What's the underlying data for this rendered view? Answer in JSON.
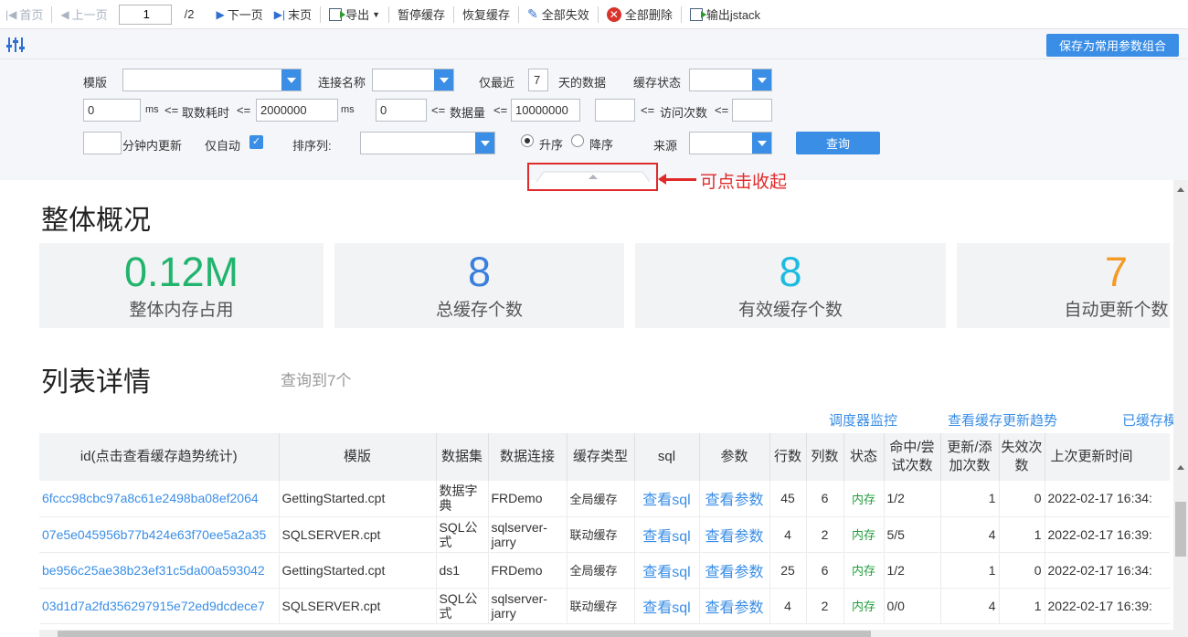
{
  "toolbar": {
    "first_page": "首页",
    "prev_page": "上一页",
    "page_current": "1",
    "page_total": "/2",
    "next_page": "下一页",
    "last_page": "末页",
    "export": "导出",
    "pause_cache": "暂停缓存",
    "resume_cache": "恢复缓存",
    "invalidate_all": "全部失效",
    "delete_all": "全部删除",
    "export_jstack": "输出jstack"
  },
  "filters": {
    "save_combo_label": "保存为常用参数组合",
    "template_label": "模版",
    "template_value": "",
    "connection_label": "连接名称",
    "connection_value": "",
    "recent_prefix": "仅最近",
    "recent_days": "7",
    "recent_suffix": "天的数据",
    "cache_status_label": "缓存状态",
    "cache_status_value": "",
    "fetch_time_min": "0",
    "ms_le_1": "ms",
    "le_a": "<=",
    "fetch_time_label": "取数耗时",
    "le_b": "<=",
    "fetch_time_max": "2000000",
    "ms_2": "ms",
    "data_amount_min": "0",
    "le_c": "<=",
    "data_amount_label": "数据量",
    "le_d": "<=",
    "data_amount_max": "10000000",
    "visits_min": "",
    "le_e": "<=",
    "visits_label": "访问次数",
    "le_f": "<=",
    "visits_max": "",
    "updated_minutes_value": "",
    "updated_minutes_label": "分钟内更新",
    "auto_only_label": "仅自动",
    "auto_only_checked": true,
    "sort_label": "排序列:",
    "sort_value": "",
    "asc_label": "升序",
    "desc_label": "降序",
    "source_label": "来源",
    "source_value": "",
    "query_button": "查询"
  },
  "annotation": {
    "collapse_text": "可点击收起"
  },
  "overview": {
    "title": "整体概况",
    "cards": [
      {
        "value": "0.12M",
        "label": "整体内存占用",
        "color": "#21b46d"
      },
      {
        "value": "8",
        "label": "总缓存个数",
        "color": "#3a7fdd"
      },
      {
        "value": "8",
        "label": "有效缓存个数",
        "color": "#1ebbe0"
      },
      {
        "value": "7",
        "label": "自动更新个数",
        "color": "#f39a27"
      }
    ]
  },
  "details": {
    "title": "列表详情",
    "result_count": "查询到7个",
    "links": [
      "调度器监控",
      "查看缓存更新趋势",
      "已缓存模"
    ],
    "columns": [
      "id(点击查看缓存趋势统计)",
      "模版",
      "数据集",
      "数据连接",
      "缓存类型",
      "sql",
      "参数",
      "行数",
      "列数",
      "状态",
      "命中/尝试次数",
      "更新/添加次数",
      "失效次数",
      "上次更新时间"
    ],
    "rows": [
      {
        "id": "6fccc98cbc97a8c61e2498ba08ef2064",
        "template": "GettingStarted.cpt",
        "dataset": "数据字典",
        "connection": "FRDemo",
        "cache_type": "全局缓存",
        "sql": "查看sql",
        "params": "查看参数",
        "rows": "45",
        "cols": "6",
        "status": "内存",
        "hits": "1/2",
        "updates": "1",
        "invalid": "0",
        "last_update": "2022-02-17 16:34:"
      },
      {
        "id": "07e5e045956b77b424e63f70ee5a2a35",
        "template": "SQLSERVER.cpt",
        "dataset": "SQL公式",
        "connection": "sqlserver-jarry",
        "cache_type": "联动缓存",
        "sql": "查看sql",
        "params": "查看参数",
        "rows": "4",
        "cols": "2",
        "status": "内存",
        "hits": "5/5",
        "updates": "4",
        "invalid": "1",
        "last_update": "2022-02-17 16:39:"
      },
      {
        "id": "be956c25ae38b23ef31c5da00a593042",
        "template": "GettingStarted.cpt",
        "dataset": "ds1",
        "connection": "FRDemo",
        "cache_type": "全局缓存",
        "sql": "查看sql",
        "params": "查看参数",
        "rows": "25",
        "cols": "6",
        "status": "内存",
        "hits": "1/2",
        "updates": "1",
        "invalid": "0",
        "last_update": "2022-02-17 16:34:"
      },
      {
        "id": "03d1d7a2fd356297915e72ed9dcdece7",
        "template": "SQLSERVER.cpt",
        "dataset": "SQL公式",
        "connection": "sqlserver-jarry",
        "cache_type": "联动缓存",
        "sql": "查看sql",
        "params": "查看参数",
        "rows": "4",
        "cols": "2",
        "status": "内存",
        "hits": "0/0",
        "updates": "4",
        "invalid": "1",
        "last_update": "2022-02-17 16:39:"
      }
    ]
  }
}
